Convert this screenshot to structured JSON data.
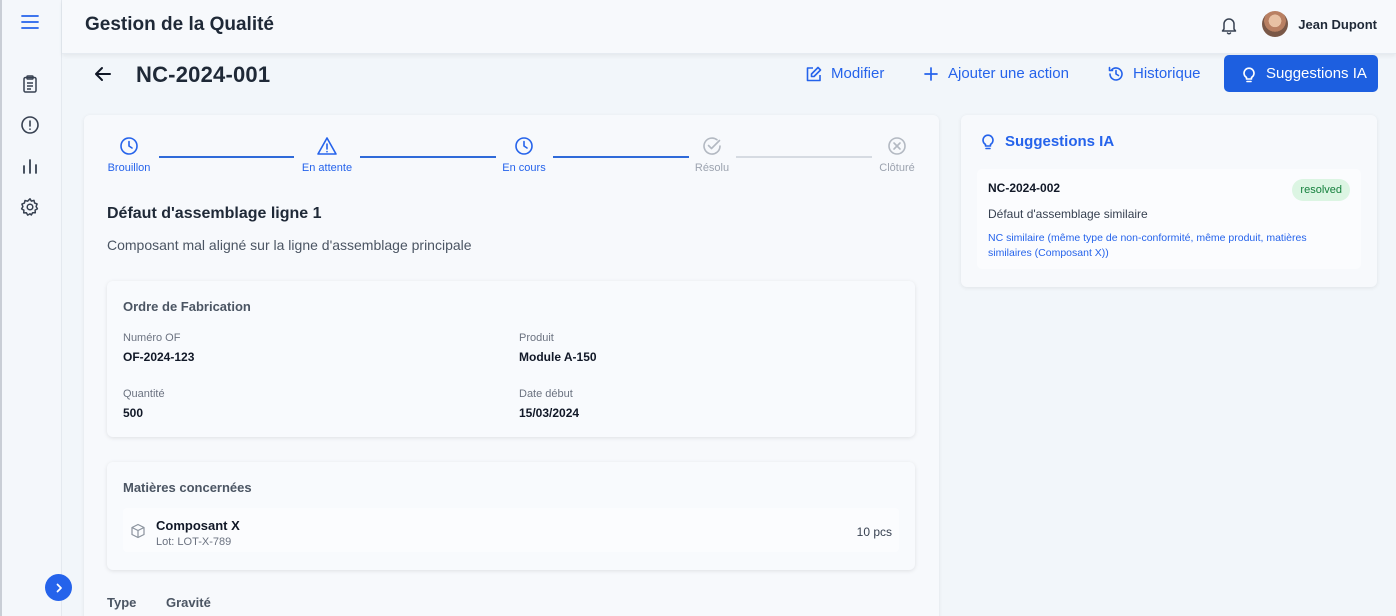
{
  "app": {
    "title": "Gestion de la Qualité"
  },
  "sidebar": {
    "icons": [
      "menu-icon",
      "clipboard-icon",
      "alert-circle-icon",
      "bar-chart-icon",
      "settings-icon"
    ],
    "collapse_icon": "chevron-right-icon"
  },
  "header": {
    "user_name": "Jean Dupont",
    "bell_icon": "bell-icon"
  },
  "page": {
    "title": "NC-2024-001",
    "actions": [
      {
        "label": "Modifier",
        "icon": "edit-icon"
      },
      {
        "label": "Ajouter une action",
        "icon": "plus-icon"
      },
      {
        "label": "Historique",
        "icon": "history-icon"
      },
      {
        "label": "Suggestions IA",
        "icon": "lightbulb-icon"
      }
    ]
  },
  "stepper": {
    "steps": [
      {
        "label": "Brouillon",
        "icon": "clock-icon",
        "active": true
      },
      {
        "label": "En attente",
        "icon": "warning-icon",
        "active": true
      },
      {
        "label": "En cours",
        "icon": "clock-icon",
        "active": true
      },
      {
        "label": "Résolu",
        "icon": "check-circle-icon",
        "active": false
      },
      {
        "label": "Clôturé",
        "icon": "x-circle-icon",
        "active": false
      }
    ]
  },
  "nc": {
    "title": "Défaut d'assemblage ligne 1",
    "description": "Composant mal aligné sur la ligne d'assemblage principale"
  },
  "of": {
    "section_title": "Ordre de Fabrication",
    "numero_label": "Numéro OF",
    "numero_value": "OF-2024-123",
    "produit_label": "Produit",
    "produit_value": "Module A-150",
    "quantite_label": "Quantité",
    "quantite_value": "500",
    "date_label": "Date début",
    "date_value": "15/03/2024"
  },
  "materials": {
    "section_title": "Matières concernées",
    "items": [
      {
        "name": "Composant X",
        "lot": "Lot: LOT-X-789",
        "qty": "10 pcs",
        "icon": "package-icon"
      }
    ]
  },
  "details": {
    "type_label": "Type",
    "gravite_label": "Gravité"
  },
  "ai": {
    "title": "Suggestions IA",
    "suggestions": [
      {
        "id": "NC-2024-002",
        "status": "resolved",
        "title": "Défaut d'assemblage similaire",
        "reason": "NC similaire (même type de non-conformité, même produit, matières similaires (Composant X))"
      }
    ]
  },
  "colors": {
    "accent": "#2563eb",
    "primary_button": "#1d5fe0",
    "badge_bg": "#dcf5e3",
    "badge_text": "#15803d"
  }
}
